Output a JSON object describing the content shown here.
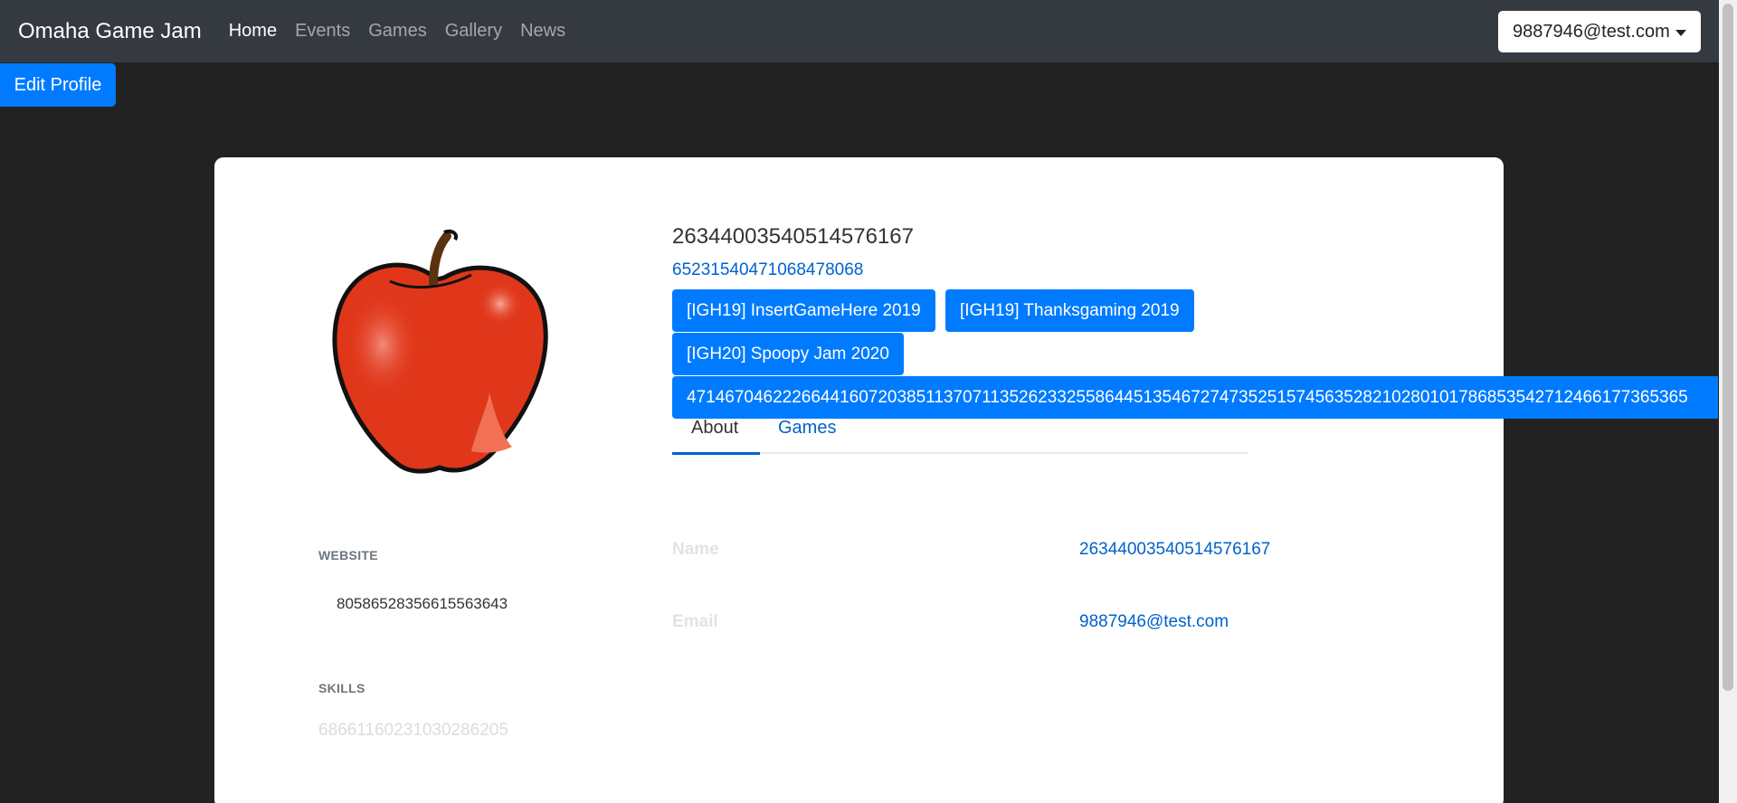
{
  "navbar": {
    "brand": "Omaha Game Jam",
    "items": [
      {
        "label": "Home",
        "active": true
      },
      {
        "label": "Events",
        "active": false
      },
      {
        "label": "Games",
        "active": false
      },
      {
        "label": "Gallery",
        "active": false
      },
      {
        "label": "News",
        "active": false
      }
    ],
    "user_email": "9887946@test.com"
  },
  "edit_profile_label": "Edit Profile",
  "profile": {
    "avatar_icon": "apple-icon",
    "name": "26344003540514576167",
    "subtitle": "65231540471068478068",
    "events": [
      "[IGH19] InsertGameHere 2019",
      "[IGH19] Thanksgaming 2019",
      "[IGH20] Spoopy Jam 2020",
      "471467046222664416072038511370711352623325586445135467274735251574563528210280101786853542712466177365365"
    ],
    "tabs": [
      "About",
      "Games"
    ],
    "website_label": "WEBSITE",
    "website_value": "80586528356615563643",
    "skills_label": "SKILLS",
    "skills_value": "68661160231030286205",
    "about": {
      "name_label": "Name",
      "name_value": "26344003540514576167",
      "email_label": "Email",
      "email_value": "9887946@test.com"
    }
  },
  "colors": {
    "navbar_bg": "#343a40",
    "page_bg": "#222222",
    "primary": "#007bff",
    "link": "#0062cc"
  }
}
